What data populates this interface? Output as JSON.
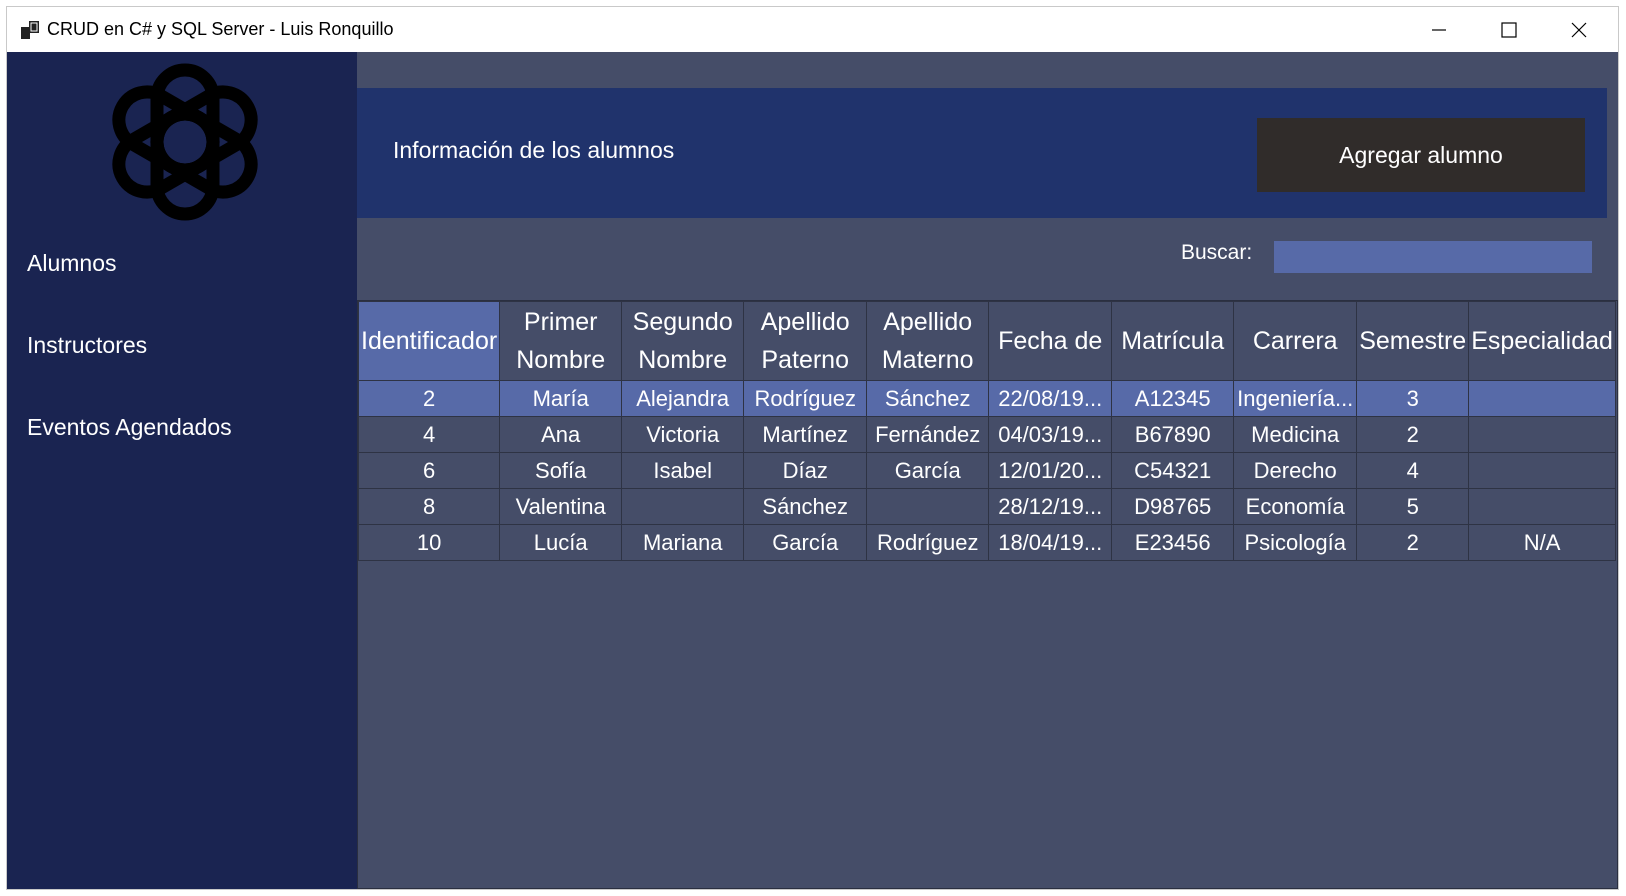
{
  "window": {
    "title": "CRUD en C# y SQL Server - Luis Ronquillo"
  },
  "sidebar": {
    "logo_icon": "openai-knot-logo",
    "items": [
      {
        "label": "Alumnos"
      },
      {
        "label": "Instructores"
      },
      {
        "label": "Eventos Agendados"
      }
    ]
  },
  "header": {
    "title": "Información de los alumnos",
    "add_button_label": "Agregar alumno"
  },
  "search": {
    "label": "Buscar:",
    "value": ""
  },
  "table": {
    "columns": [
      "Identificador",
      "Primer Nombre",
      "Segundo Nombre",
      "Apellido Paterno",
      "Apellido Materno",
      "Fecha de",
      "Matrícula",
      "Carrera",
      "Semestre",
      "Especialidad"
    ],
    "rows": [
      [
        "2",
        "María",
        "Alejandra",
        "Rodríguez",
        "Sánchez",
        "22/08/19...",
        "A12345",
        "Ingeniería...",
        "3",
        ""
      ],
      [
        "4",
        "Ana",
        "Victoria",
        "Martínez",
        "Fernández",
        "04/03/19...",
        "B67890",
        "Medicina",
        "2",
        ""
      ],
      [
        "6",
        "Sofía",
        "Isabel",
        "Díaz",
        "García",
        "12/01/20...",
        "C54321",
        "Derecho",
        "4",
        ""
      ],
      [
        "8",
        "Valentina",
        "",
        "Sánchez",
        "",
        "28/12/19...",
        "D98765",
        "Economía",
        "5",
        ""
      ],
      [
        "10",
        "Lucía",
        "Mariana",
        "García",
        "Rodríguez",
        "18/04/19...",
        "E23456",
        "Psicología",
        "2",
        "N/A"
      ]
    ],
    "selected_row": 0
  },
  "colors": {
    "sidebar_bg": "#1a2451",
    "main_bg": "#454d68",
    "header_bg": "#20336c",
    "button_bg": "#302c2a",
    "accent": "#576aa8"
  }
}
